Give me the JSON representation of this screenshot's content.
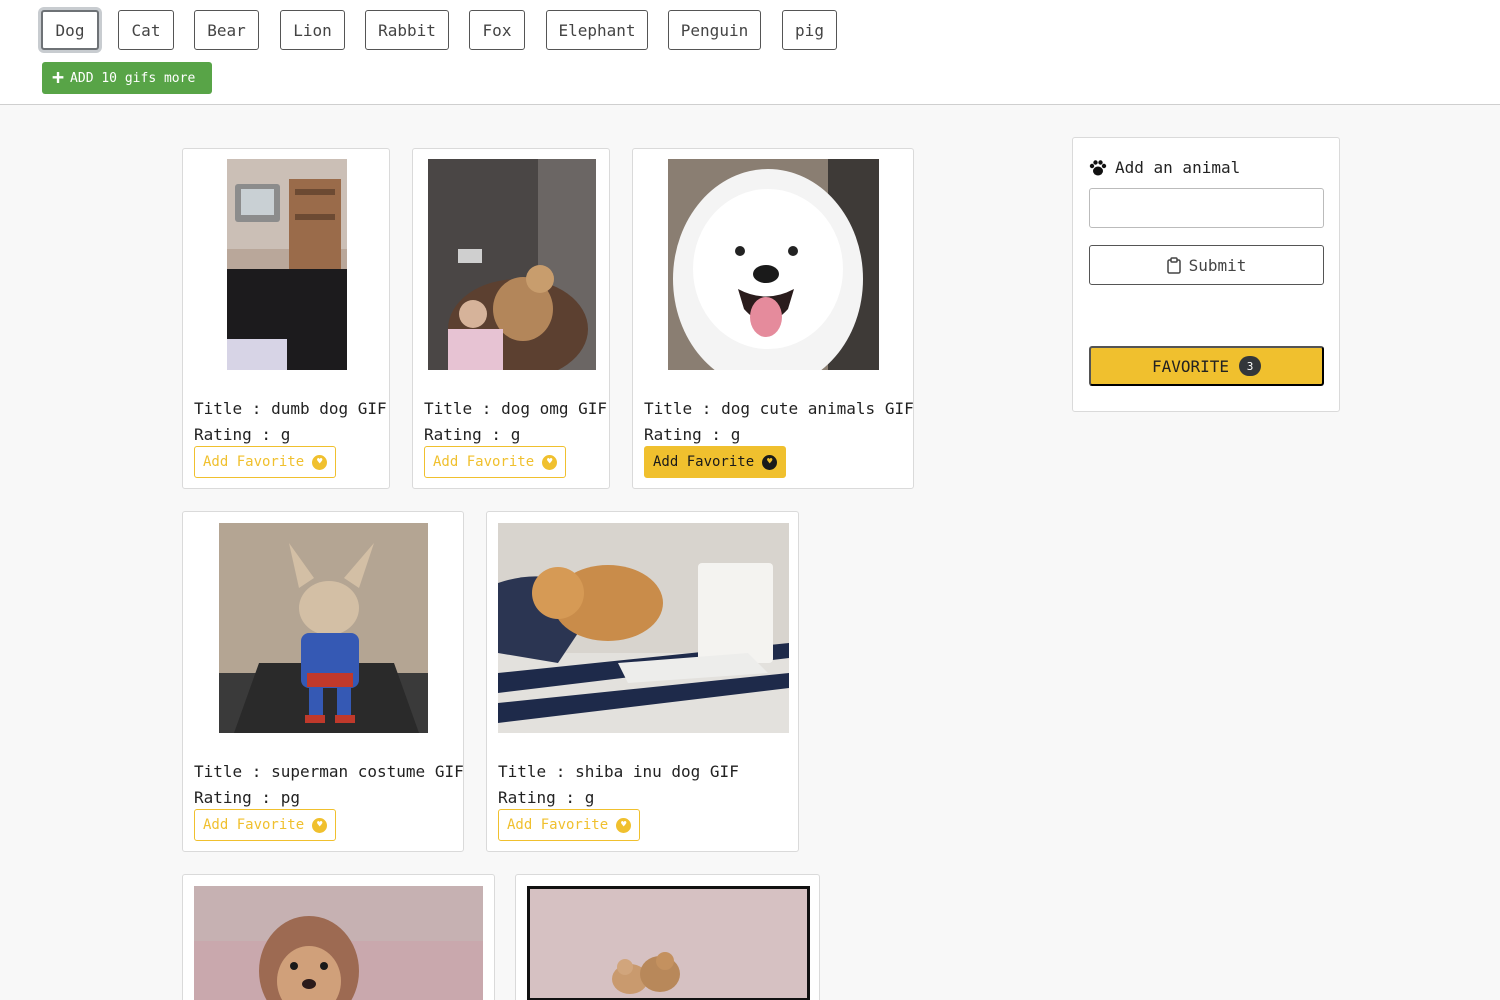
{
  "animal_buttons": [
    "Dog",
    "Cat",
    "Bear",
    "Lion",
    "Rabbit",
    "Fox",
    "Elephant",
    "Penguin",
    "pig"
  ],
  "active_animal": "Dog",
  "add_more": {
    "label": "ADD 10 gifs more",
    "icon": "plus-icon"
  },
  "gifs": [
    {
      "title": "Title : dumb dog GIF",
      "rating": "Rating : g",
      "favorite_label": "Add Favorite",
      "favorited": false
    },
    {
      "title": "Title : dog omg GIF",
      "rating": "Rating : g",
      "favorite_label": "Add Favorite",
      "favorited": false
    },
    {
      "title": "Title : dog cute animals GIF",
      "rating": "Rating : g",
      "favorite_label": "Add Favorite",
      "favorited": true
    },
    {
      "title": "Title : superman costume GIF",
      "rating": "Rating : pg",
      "favorite_label": "Add Favorite",
      "favorited": false
    },
    {
      "title": "Title : shiba inu dog GIF",
      "rating": "Rating : g",
      "favorite_label": "Add Favorite",
      "favorited": false
    }
  ],
  "sidebar": {
    "heading": "Add an animal",
    "heading_icon": "paw-icon",
    "input_value": "",
    "submit_label": "Submit",
    "submit_icon": "clipboard-icon",
    "favorite_label": "FAVORITE",
    "favorite_count": "3"
  },
  "colors": {
    "accent": "#f0c02e",
    "success": "#58a447",
    "badge": "#33363a"
  }
}
